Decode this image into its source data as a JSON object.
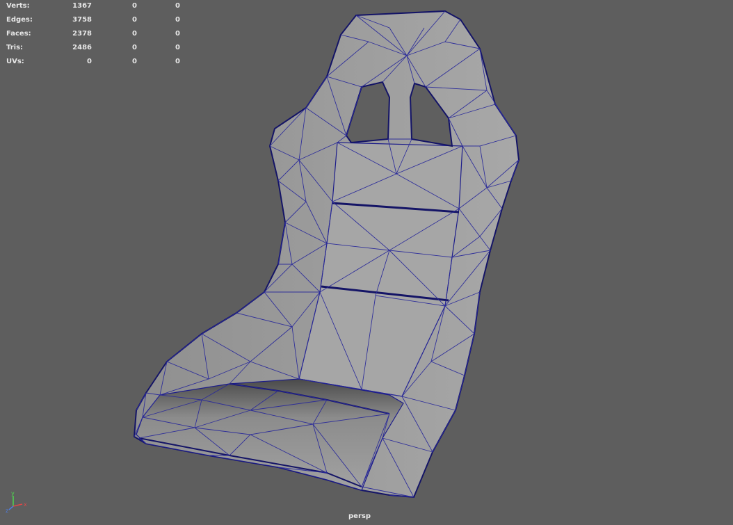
{
  "viewport": {
    "camera": "persp",
    "background": "#5e5e5e",
    "mesh_color": "#9a9a9a",
    "wire_color": "#1c1c8a"
  },
  "hud": {
    "rows": [
      {
        "label": "Verts:",
        "v1": "1367",
        "v2": "0",
        "v3": "0"
      },
      {
        "label": "Edges:",
        "v1": "3758",
        "v2": "0",
        "v3": "0"
      },
      {
        "label": "Faces:",
        "v1": "2378",
        "v2": "0",
        "v3": "0"
      },
      {
        "label": "Tris:",
        "v1": "2486",
        "v2": "0",
        "v3": "0"
      },
      {
        "label": "UVs:",
        "v1": "0",
        "v2": "0",
        "v3": "0"
      }
    ]
  },
  "axis": {
    "x": "x",
    "y": "y",
    "z": "z"
  }
}
